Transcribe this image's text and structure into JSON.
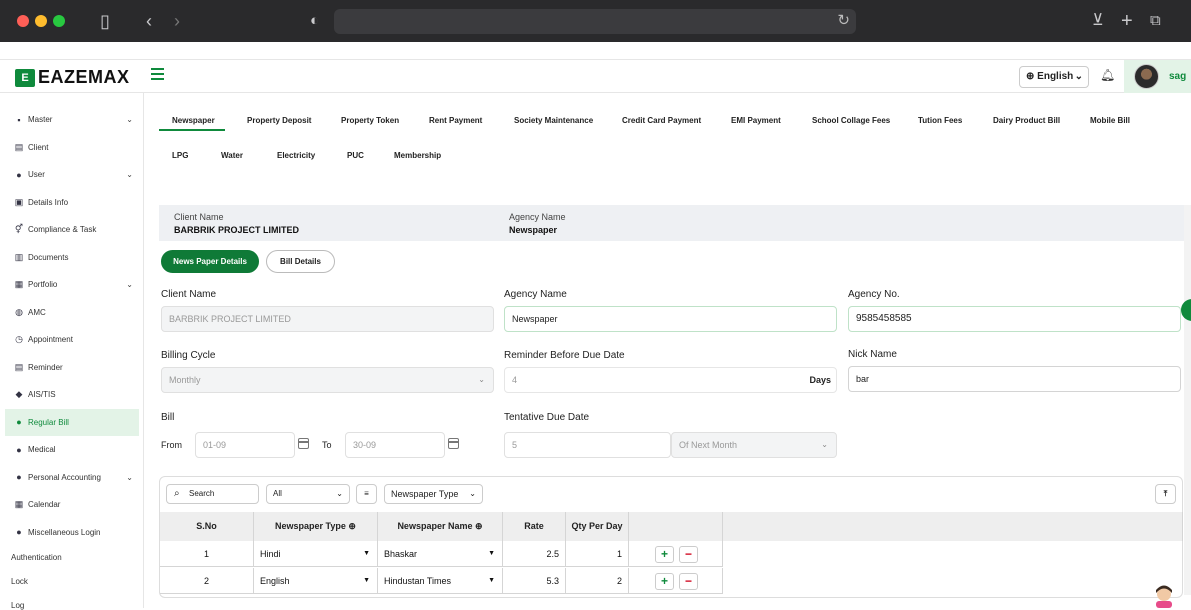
{
  "app": {
    "logo_mark": "E",
    "logo_text": "EAZEMAX",
    "language": "English",
    "user": "sag"
  },
  "sidebar": {
    "items": [
      {
        "label": "Master",
        "icon": "folder-icon",
        "chevron": true
      },
      {
        "label": "Client",
        "icon": "document-icon",
        "chevron": false
      },
      {
        "label": "User",
        "icon": "user-icon",
        "chevron": true
      },
      {
        "label": "Details Info",
        "icon": "details-icon",
        "chevron": false
      },
      {
        "label": "Compliance & Task",
        "icon": "gender-icon",
        "chevron": false
      },
      {
        "label": "Documents",
        "icon": "documents-icon",
        "chevron": false
      },
      {
        "label": "Portfolio",
        "icon": "portfolio-icon",
        "chevron": true
      },
      {
        "label": "AMC",
        "icon": "globe-icon",
        "chevron": false
      },
      {
        "label": "Appointment",
        "icon": "appointment-icon",
        "chevron": false
      },
      {
        "label": "Reminder",
        "icon": "reminder-icon",
        "chevron": false
      },
      {
        "label": "AIS/TIS",
        "icon": "tag-icon",
        "chevron": false
      },
      {
        "label": "Regular Bill",
        "icon": "bill-user-icon",
        "chevron": false
      },
      {
        "label": "Medical",
        "icon": "medical-icon",
        "chevron": false
      },
      {
        "label": "Personal Accounting",
        "icon": "accounting-icon",
        "chevron": true
      },
      {
        "label": "Calendar",
        "icon": "calendar-icon",
        "chevron": false
      },
      {
        "label": "Miscellaneous Login",
        "icon": "login-icon",
        "chevron": false
      }
    ],
    "plain": [
      "Authentication",
      "Lock",
      "Log"
    ]
  },
  "tabs_row1": [
    "Newspaper",
    "Property Deposit",
    "Property Token",
    "Rent Payment",
    "Society Maintenance",
    "Credit Card Payment",
    "EMI Payment",
    "School Collage Fees",
    "Tution Fees",
    "Dairy Product Bill",
    "Mobile Bill"
  ],
  "tabs_row2": [
    "LPG",
    "Water",
    "Electricity",
    "PUC",
    "Membership"
  ],
  "info": {
    "client_label": "Client Name",
    "client_value": "BARBRIK PROJECT LIMITED",
    "agency_label": "Agency Name",
    "agency_value": "Newspaper"
  },
  "sections": {
    "details": "News Paper Details",
    "bill": "Bill Details"
  },
  "form": {
    "client_name_label": "Client Name",
    "client_name_value": "BARBRIK PROJECT LIMITED",
    "agency_name_label": "Agency Name",
    "agency_name_value": "Newspaper",
    "agency_no_label": "Agency No.",
    "agency_no_value": "9585458585",
    "billing_cycle_label": "Billing Cycle",
    "billing_cycle_value": "Monthly",
    "reminder_label": "Reminder Before Due Date",
    "reminder_value": "4",
    "reminder_suffix": "Days",
    "nick_label": "Nick Name",
    "nick_value": "bar",
    "bill_label": "Bill",
    "from_label": "From",
    "from_value": "01-09",
    "to_label": "To",
    "to_value": "30-09",
    "due_label": "Tentative Due Date",
    "due_value": "5",
    "due_suffix": "Of Next Month"
  },
  "table": {
    "search_placeholder": "Search",
    "filter_value": "All",
    "type_filter": "Newspaper Type",
    "headers": [
      "S.No",
      "Newspaper Type",
      "Newspaper Name",
      "Rate",
      "Qty Per Day"
    ],
    "rows": [
      {
        "sno": "1",
        "type": "Hindi",
        "name": "Bhaskar",
        "rate": "2.5",
        "qty": "1"
      },
      {
        "sno": "2",
        "type": "English",
        "name": "Hindustan Times",
        "rate": "5.3",
        "qty": "2"
      }
    ],
    "plus": "+",
    "minus": "−"
  },
  "colors": {
    "brand": "#0f8a3c",
    "active_bg": "#e3f3e7",
    "danger": "#d0021b"
  }
}
